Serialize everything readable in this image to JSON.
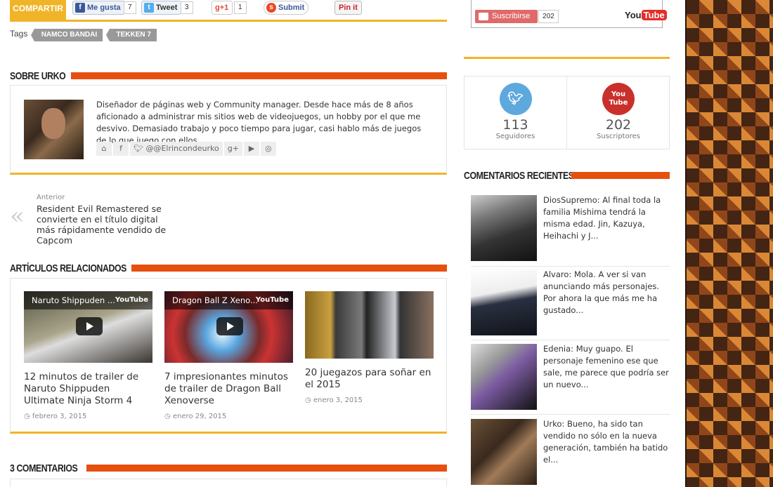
{
  "share": {
    "compartir": "COMPARTIR",
    "fb_label": "Me gusta",
    "fb_count": "7",
    "tw_label": "Tweet",
    "tw_count": "3",
    "gp_label": "+1",
    "gp_count": "1",
    "su_label": "Submit",
    "pin_label": "Pin it"
  },
  "tags": {
    "label": "Tags",
    "items": [
      "NAMCO BANDAI",
      "TEKKEN 7"
    ]
  },
  "author": {
    "section_title": "SOBRE URKO",
    "bio": "Diseñador de páginas web y Community manager. Desde hace más de 8 años aficionado a administrar mis sitios web de videojuegos, un hobby por el que me desvivo. Demasiado trabajo y poco tiempo para jugar, casi hablo más de juegos de lo que juego con ellos.",
    "twitter": "@@Elrincondeurko"
  },
  "prev_post": {
    "label": "Anterior",
    "title": "Resident Evil Remastered se convierte en el título digital más rápidamente vendido de Capcom"
  },
  "related": {
    "section_title": "ARTÍCULOS RELACIONADOS",
    "items": [
      {
        "video_title": "Naruto Shippuden ...",
        "video_source": "YouTube",
        "title": "12 minutos de trailer de Naruto Shippuden Ultimate Ninja Storm 4",
        "date": "febrero 3, 2015"
      },
      {
        "video_title": "Dragon Ball Z Xeno...",
        "video_source": "YouTube",
        "title": "7 impresionantes minutos de trailer de Dragon Ball Xenoverse",
        "date": "enero 29, 2015"
      },
      {
        "title": "20 juegazos para soñar en el 2015",
        "date": "enero 3, 2015"
      }
    ]
  },
  "comments_section": {
    "title": "3 COMENTARIOS"
  },
  "sidebar": {
    "youtube": {
      "subscribe": "Suscribirse",
      "count": "202",
      "logo_you": "You",
      "logo_tube": "Tube"
    },
    "stats": [
      {
        "icon": "twitter-icon",
        "number": "113",
        "label": "Seguidores",
        "color": "#5da9dd"
      },
      {
        "icon": "youtube-icon",
        "number": "202",
        "label": "Suscriptores",
        "color": "#c9302c",
        "icon_text_1": "You",
        "icon_text_2": "Tube"
      }
    ],
    "recent_comments": {
      "title": "COMENTARIOS RECIENTES",
      "items": [
        {
          "author": "DiosSupremo",
          "text": "DiosSupremo: Al final toda la familia Mishima tendrá la misma edad. Jin, Kazuya, Heihachi y J..."
        },
        {
          "author": "Alvaro",
          "text": "Alvaro: Mola. A ver si van anunciando más personajes. Por ahora la que más me ha gustado..."
        },
        {
          "author": "Edenia",
          "text": "Edenia: Muy guapo. El personaje femenino ese que sale, me parece que podría ser un nuevo..."
        },
        {
          "author": "Urko",
          "text": "Urko: Bueno, ha sido tan vendido no sólo en la nueva generación, también ha batido el..."
        }
      ]
    }
  },
  "colors": {
    "accent_orange": "#e5500f",
    "accent_yellow": "#f0b429",
    "twitter": "#5da9dd",
    "youtube": "#c9302c"
  }
}
